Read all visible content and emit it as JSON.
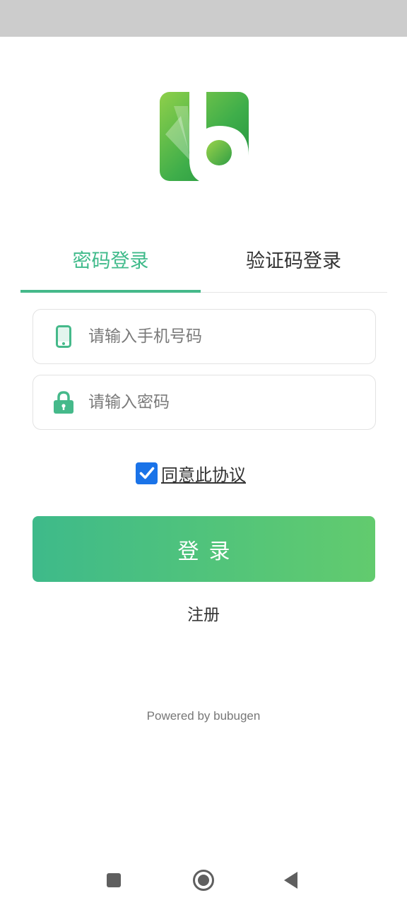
{
  "app": {
    "logo_icon": "bubugen-b-logo-icon",
    "accent_color": "#45b98a",
    "button_gradient": [
      "#3eba8a",
      "#62cb6e"
    ]
  },
  "tabs": [
    {
      "label": "密码登录",
      "active": true
    },
    {
      "label": "验证码登录",
      "active": false
    }
  ],
  "form": {
    "phone": {
      "placeholder": "请输入手机号码",
      "value": "",
      "icon": "phone-icon"
    },
    "password": {
      "placeholder": "请输入密码",
      "value": "",
      "icon": "lock-icon"
    }
  },
  "agreement": {
    "label": "同意此协议",
    "checked": true,
    "checkbox_color": "#1a73e8"
  },
  "login_button": {
    "label": "登录"
  },
  "register_link": {
    "label": "注册"
  },
  "footer": {
    "powered_by": "Powered by bubugen"
  },
  "system_nav": {
    "recents_icon": "square-recents-icon",
    "home_icon": "circle-home-icon",
    "back_icon": "triangle-back-icon"
  }
}
